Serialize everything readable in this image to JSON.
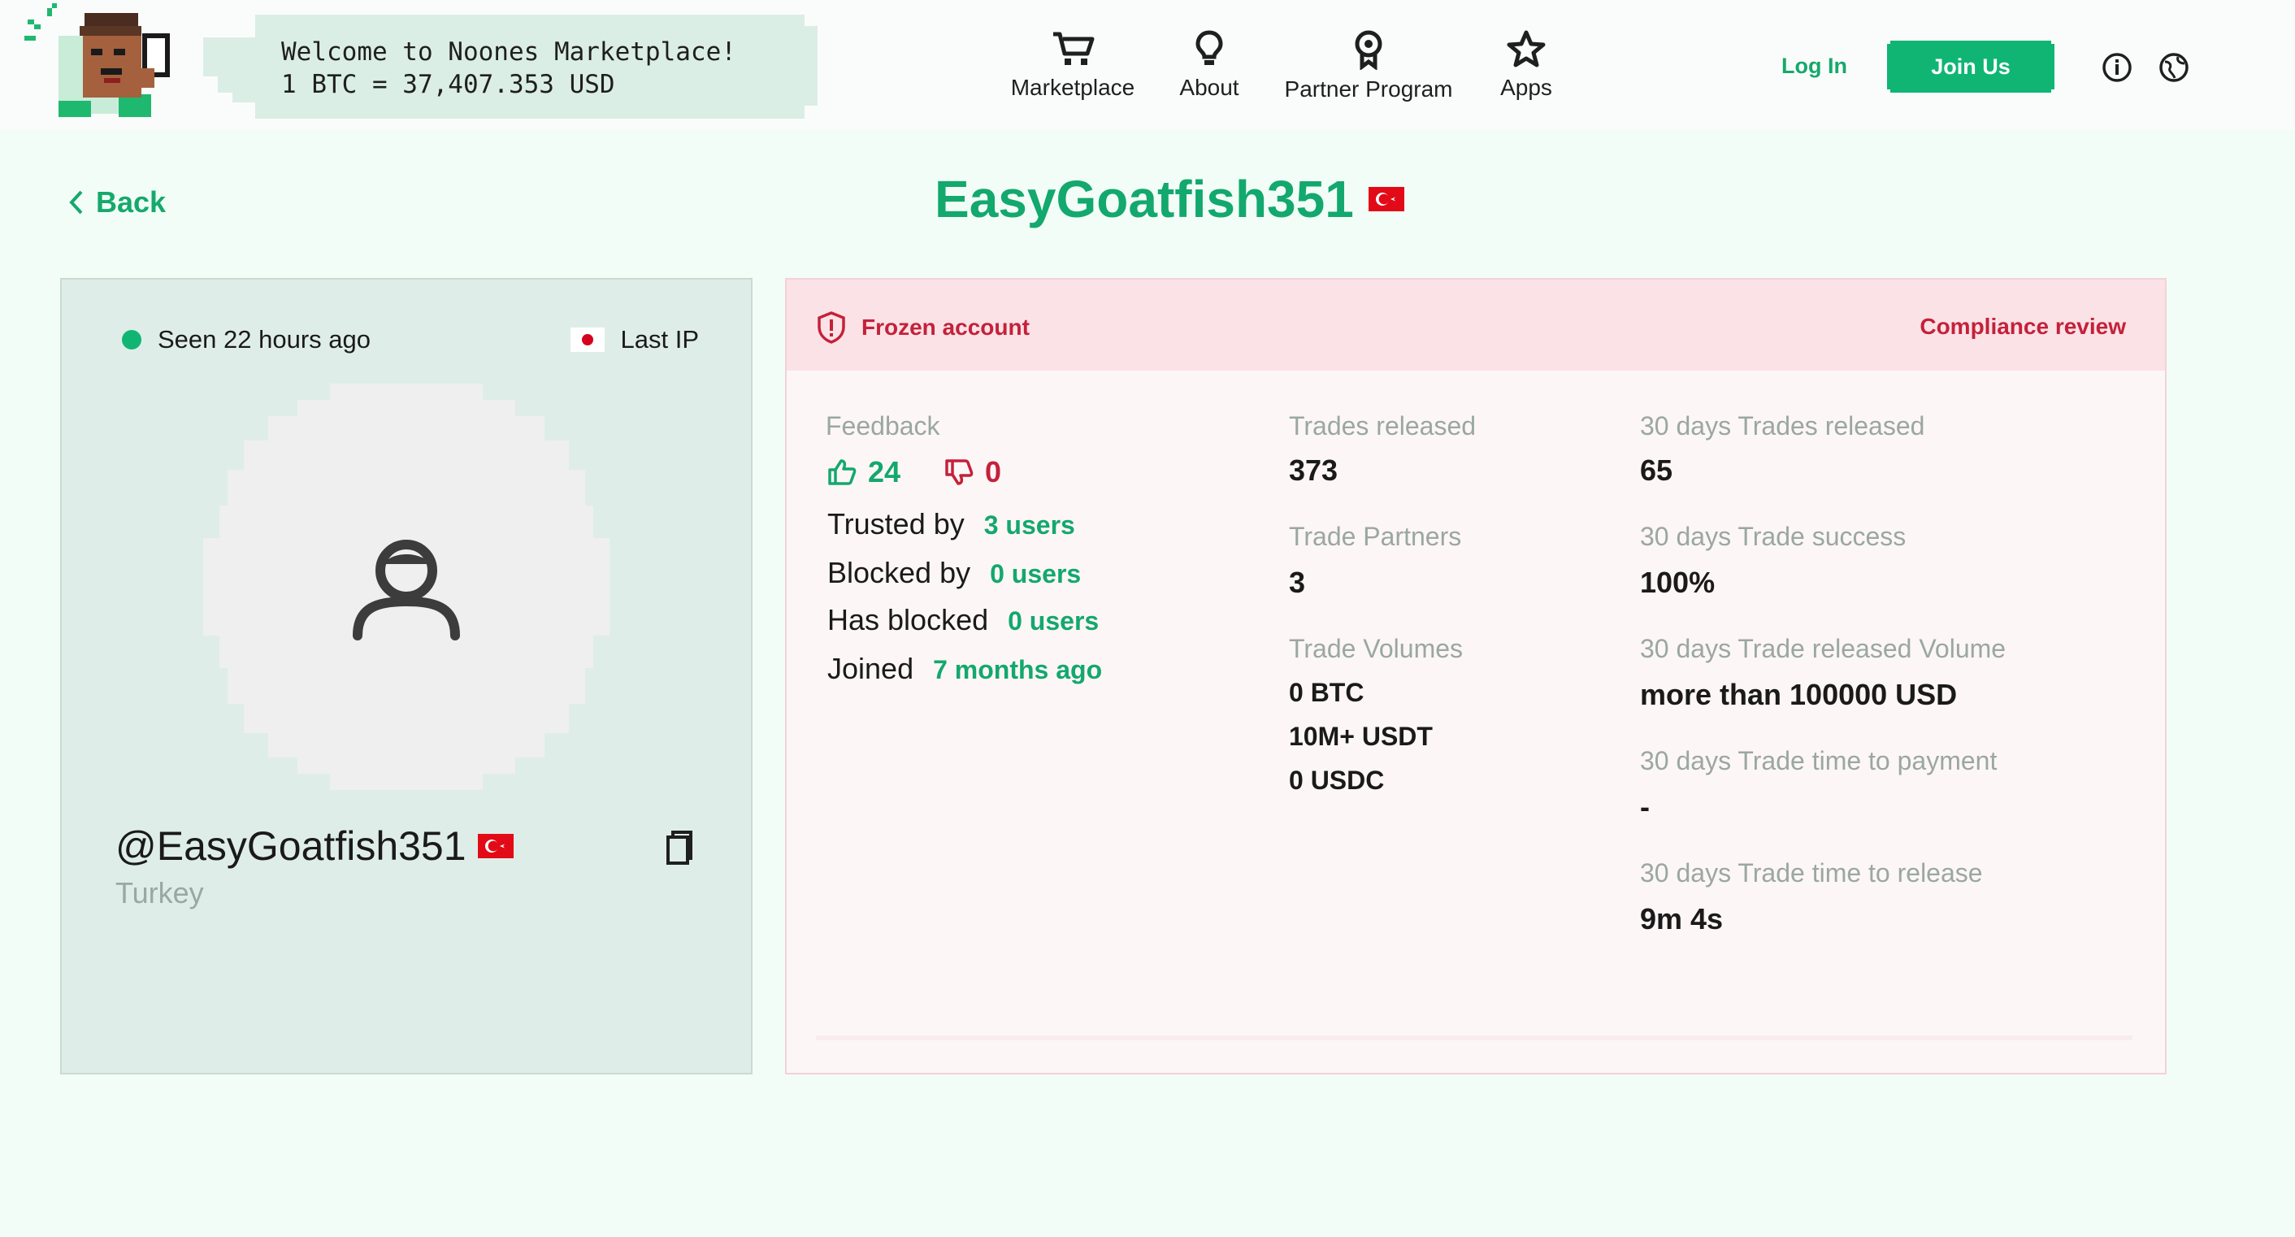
{
  "header": {
    "welcome_line1": "Welcome to Noones Marketplace!",
    "welcome_line2": "1 BTC = 37,407.353 USD",
    "nav": [
      {
        "label": "Marketplace",
        "icon": "cart-icon"
      },
      {
        "label": "About",
        "icon": "lightbulb-icon"
      },
      {
        "label": "Partner Program",
        "icon": "badge-icon"
      },
      {
        "label": "Apps",
        "icon": "star-icon"
      }
    ],
    "login_label": "Log In",
    "join_label": "Join Us",
    "brand_color": "#10b574"
  },
  "page": {
    "back_label": "Back",
    "title": "EasyGoatfish351"
  },
  "profile": {
    "seen_text": "Seen 22 hours ago",
    "last_ip_label": "Last IP",
    "handle": "@EasyGoatfish351",
    "country": "Turkey"
  },
  "status": {
    "frozen_label": "Frozen account",
    "compliance_label": "Compliance review",
    "alert_color": "#c4213a"
  },
  "feedback": {
    "label": "Feedback",
    "positive": "24",
    "negative": "0",
    "rows": [
      {
        "label": "Trusted by",
        "value": "3 users"
      },
      {
        "label": "Blocked by",
        "value": "0 users"
      },
      {
        "label": "Has blocked",
        "value": "0 users"
      },
      {
        "label": "Joined",
        "value": "7 months ago"
      }
    ]
  },
  "trades": {
    "released_label": "Trades released",
    "released_value": "373",
    "partners_label": "Trade Partners",
    "partners_value": "3",
    "volumes_label": "Trade Volumes",
    "volumes": [
      "0 BTC",
      "10M+ USDT",
      "0 USDC"
    ]
  },
  "thirty_days": {
    "released_label": "30 days Trades released",
    "released_value": "65",
    "success_label": "30 days Trade success",
    "success_value": "100%",
    "volume_label": "30 days Trade released Volume",
    "volume_value": "more than 100000 USD",
    "time_to_payment_label": "30 days Trade time to payment",
    "time_to_payment_value": "-",
    "time_to_release_label": "30 days Trade time to release",
    "time_to_release_value": "9m 4s"
  }
}
